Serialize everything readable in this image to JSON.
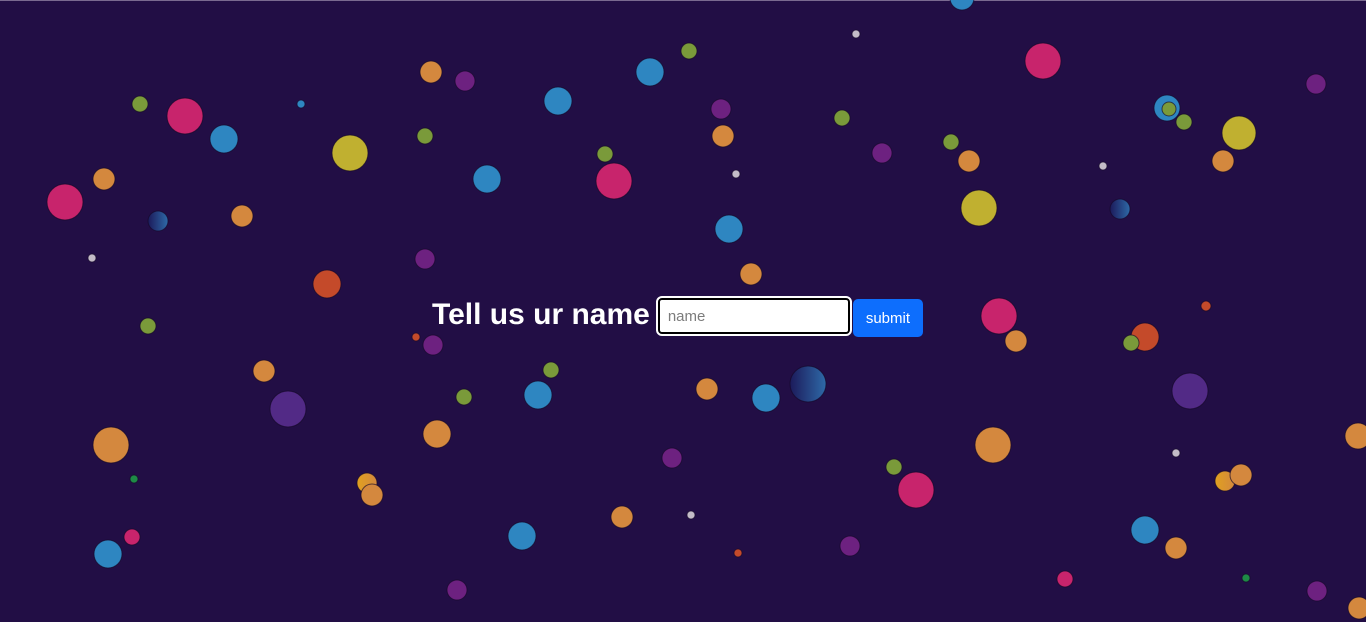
{
  "form": {
    "title": "Tell us ur name",
    "input_placeholder": "name",
    "input_value": "",
    "submit_label": "submit"
  },
  "colors": {
    "background": "#220e45",
    "submit_button": "#0d6efd",
    "bubble_palette": [
      "#2e86c1",
      "#d4883e",
      "#c8246c",
      "#7a9a3a",
      "#6d2180",
      "#c0b030",
      "#c44a2a",
      "#522a86",
      "#c4bcc8",
      "#1e8a46"
    ]
  }
}
